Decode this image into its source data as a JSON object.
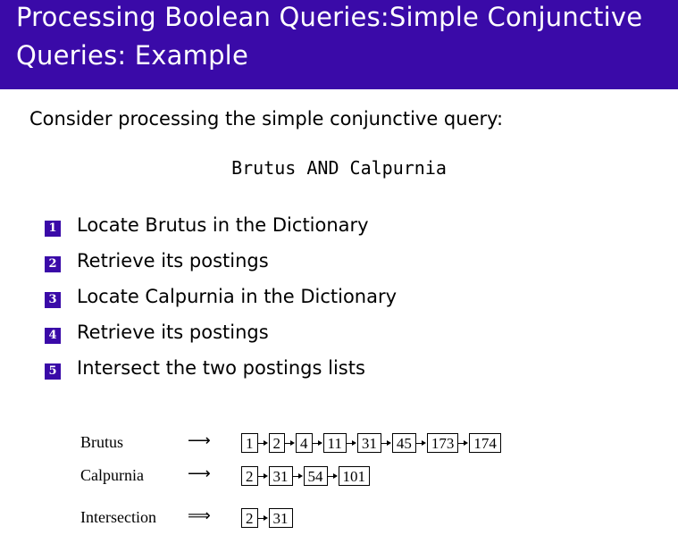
{
  "header": {
    "title_line1": "Processing Boolean Queries:Simple Conjunctive",
    "title_line2": "Queries: Example",
    "color": "#3a0aa8"
  },
  "intro": "Consider processing the simple conjunctive query:",
  "query": "Brutus AND Calpurnia",
  "steps": [
    {
      "num": "1",
      "text": "Locate Brutus in the Dictionary"
    },
    {
      "num": "2",
      "text": "Retrieve its postings"
    },
    {
      "num": "3",
      "text": "Locate Calpurnia in the Dictionary"
    },
    {
      "num": "4",
      "text": "Retrieve its postings"
    },
    {
      "num": "5",
      "text": "Intersect the two postings lists"
    }
  ],
  "figure": {
    "rows": [
      {
        "label": "Brutus",
        "arrow": "⟶",
        "postings": [
          "1",
          "2",
          "4",
          "11",
          "31",
          "45",
          "173",
          "174"
        ]
      },
      {
        "label": "Calpurnia",
        "arrow": "⟶",
        "postings": [
          "2",
          "31",
          "54",
          "101"
        ]
      },
      {
        "label": "Intersection",
        "arrow": "⟹",
        "postings": [
          "2",
          "31"
        ]
      }
    ]
  }
}
